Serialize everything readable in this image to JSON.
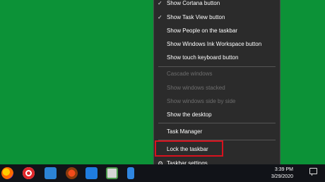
{
  "menu": {
    "items": [
      {
        "label": "Show Cortana button",
        "checked": true,
        "enabled": true
      },
      {
        "label": "Show Task View button",
        "checked": true,
        "enabled": true
      },
      {
        "label": "Show People on the taskbar",
        "enabled": true
      },
      {
        "label": "Show Windows Ink Workspace button",
        "enabled": true
      },
      {
        "label": "Show touch keyboard button",
        "enabled": true
      },
      {
        "label": "Cascade windows",
        "enabled": false
      },
      {
        "label": "Show windows stacked",
        "enabled": false
      },
      {
        "label": "Show windows side by side",
        "enabled": false
      },
      {
        "label": "Show the desktop",
        "enabled": true
      },
      {
        "label": "Task Manager",
        "enabled": true
      },
      {
        "label": "Lock the taskbar",
        "enabled": true,
        "highlighted": true
      },
      {
        "label": "Taskbar settings",
        "enabled": true,
        "icon": "gear-icon"
      }
    ]
  },
  "taskbar": {
    "apps": [
      "firefox-icon",
      "opera-icon",
      "explorer-icon",
      "paint-icon",
      "mail-icon",
      "notepad-icon",
      "phone-icon"
    ],
    "clock_time": "3:39 PM",
    "clock_date": "3/29/2020"
  },
  "colors": {
    "desktop": "#0c9237",
    "menu": "#2b2b2b",
    "highlight": "#d8121e"
  }
}
